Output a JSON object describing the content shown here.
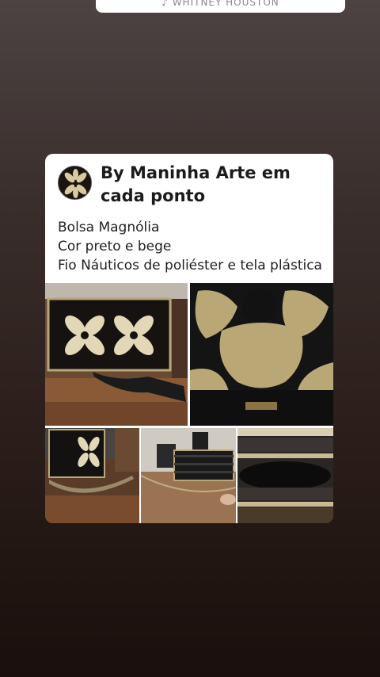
{
  "top_card": {
    "text": "♪ WHITNEY HOUSTON"
  },
  "post": {
    "author": "By Maninha Arte em cada ponto",
    "caption_lines": [
      "Bolsa Magnólia",
      "Cor preto e bege",
      "Fio Náuticos de poliéster e tela plástica"
    ],
    "photos": [
      {
        "name": "crochet-bag-front-photo"
      },
      {
        "name": "crochet-flower-closeup-photo"
      },
      {
        "name": "bag-with-strap-photo"
      },
      {
        "name": "bag-side-view-photo"
      },
      {
        "name": "bag-interior-photo"
      }
    ]
  },
  "colors": {
    "card_bg": "#ffffff",
    "text": "#1b1b1b",
    "crochet_black": "#141414",
    "crochet_beige": "#d8c9a0",
    "background_top": "#4c4342",
    "background_bottom": "#1a0f0c"
  }
}
